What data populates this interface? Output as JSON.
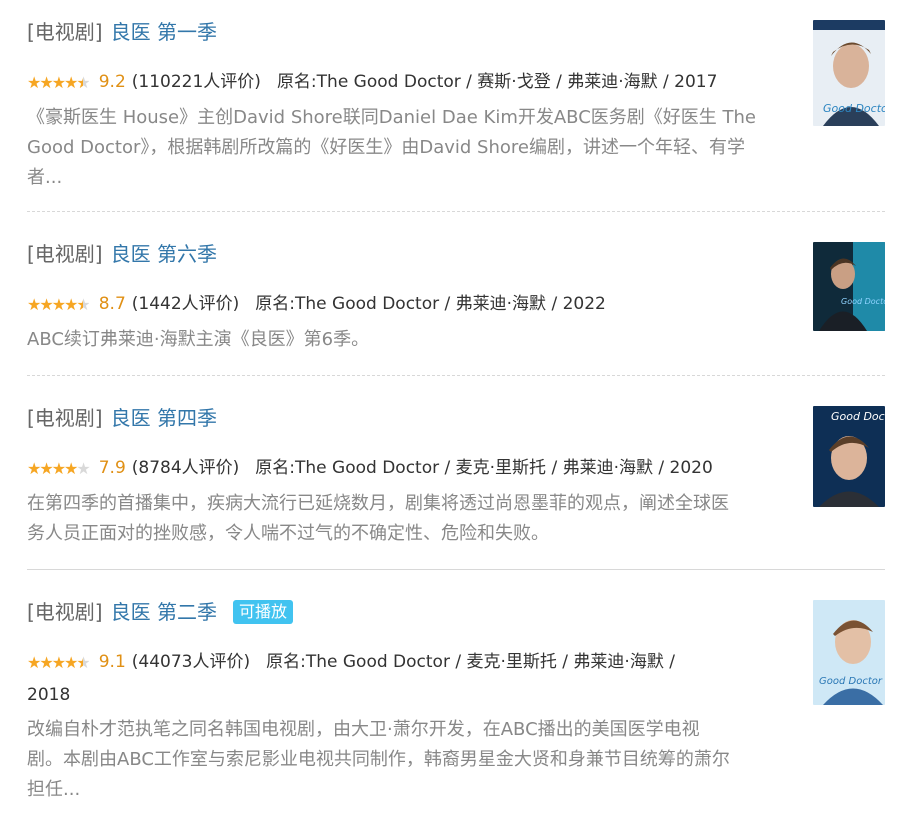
{
  "results": [
    {
      "category": "[电视剧]",
      "title": "良医 第一季",
      "stars": "full,full,full,full,half",
      "score": "9.2",
      "votes": "(110221人评价)",
      "subject": "原名:The Good Doctor / 赛斯·戈登 / 弗莱迪·海默 / 2017",
      "desc1": "《豪斯医生 House》主创David Shore联同Daniel Dae Kim开发ABC医务剧《好医生 The",
      "desc2": "Good Doctor》，根据韩剧所改篇的《好医生》由David Shore编剧，讲述一个年轻、有学",
      "desc3": "者...",
      "poster_alt": "Good Doctor"
    },
    {
      "category": "[电视剧]",
      "title": "良医 第六季",
      "stars": "full,full,full,full,half",
      "score": "8.7",
      "votes": "(1442人评价)",
      "subject": "原名:The Good Doctor / 弗莱迪·海默 / 2022",
      "desc1": "ABC续订弗莱迪·海默主演《良医》第6季。",
      "poster_alt": "Good Doctor"
    },
    {
      "category": "[电视剧]",
      "title": "良医 第四季",
      "stars": "full,full,full,full,empty",
      "score": "7.9",
      "votes": "(8784人评价)",
      "subject": "原名:The Good Doctor / 麦克·里斯托 / 弗莱迪·海默 / 2020",
      "desc1": "在第四季的首播集中，疾病大流行已延烧数月，剧集将透过尚恩墨菲的观点，阐述全球医",
      "desc2": "务人员正面对的挫败感，令人喘不过气的不确定性、危险和失败。",
      "poster_alt": "Good Doctor"
    },
    {
      "category": "[电视剧]",
      "title": "良医 第二季",
      "badge": "可播放",
      "stars": "full,full,full,full,half",
      "score": "9.1",
      "votes": "(44073人评价)",
      "subject": "原名:The Good Doctor / 麦克·里斯托 / 弗莱迪·海默 /",
      "subject2": "2018",
      "desc1": "改编自朴才范执笔之同名韩国电视剧，由大卫·萧尔开发，在ABC播出的美国医学电视",
      "desc2": "剧。本剧由ABC工作室与索尼影业电视共同制作，韩裔男星金大贤和身兼节目统筹的萧尔",
      "desc3": "担任...",
      "poster_alt": "Good Doctor"
    }
  ],
  "colors": {
    "link": "#3377aa",
    "score": "#e09015",
    "star": "#f6a623",
    "badge": "#41c3f0"
  }
}
